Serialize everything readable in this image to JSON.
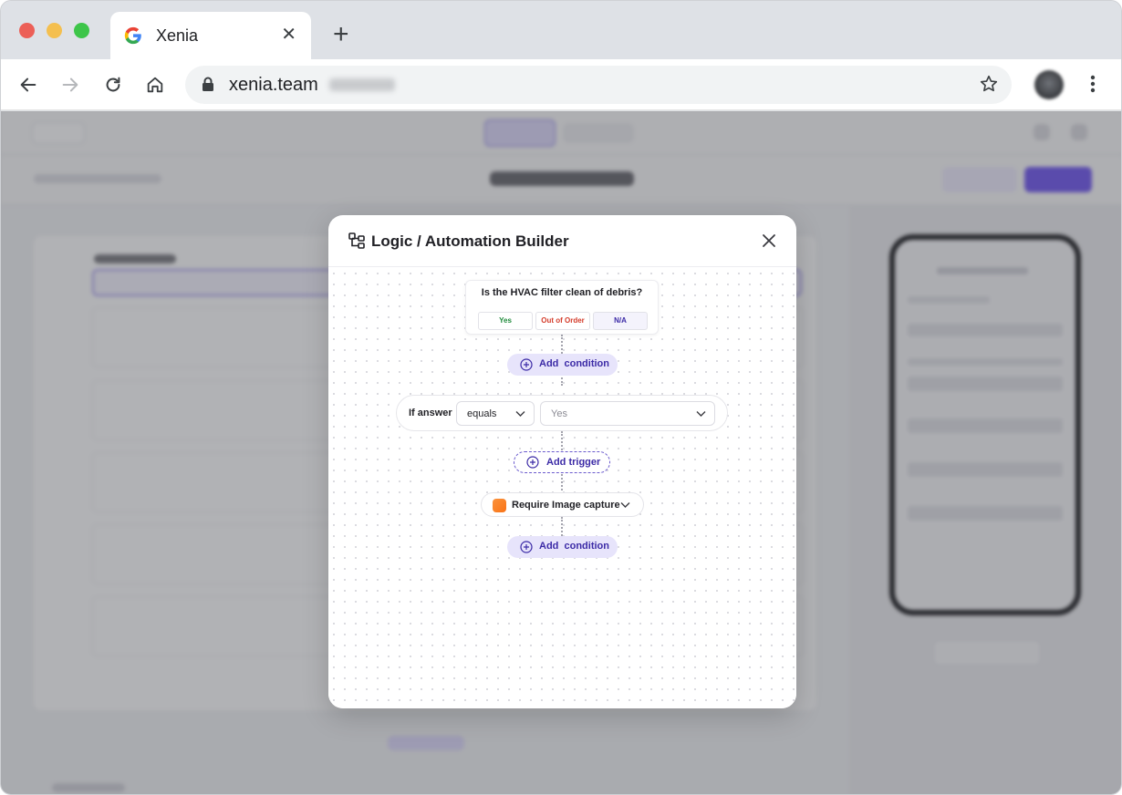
{
  "browser": {
    "tab_title": "Xenia",
    "url": "xenia.team"
  },
  "modal": {
    "title": "Logic / Automation Builder",
    "question": {
      "text": "Is the HVAC filter clean of debris?",
      "options": [
        "Yes",
        "Out of Order",
        "N/A"
      ],
      "option_colors": [
        "#1f8a3b",
        "#d43b2a",
        "#3b2aa6"
      ]
    },
    "add_condition_label": "Add  condition",
    "if_answer_label": "If answer",
    "operator_value": "equals",
    "answer_value": "Yes",
    "add_trigger_label": "Add trigger",
    "action_label": "Require Image capture",
    "add_condition_label_2": "Add  condition",
    "accent_color": "#3b2aa6"
  }
}
